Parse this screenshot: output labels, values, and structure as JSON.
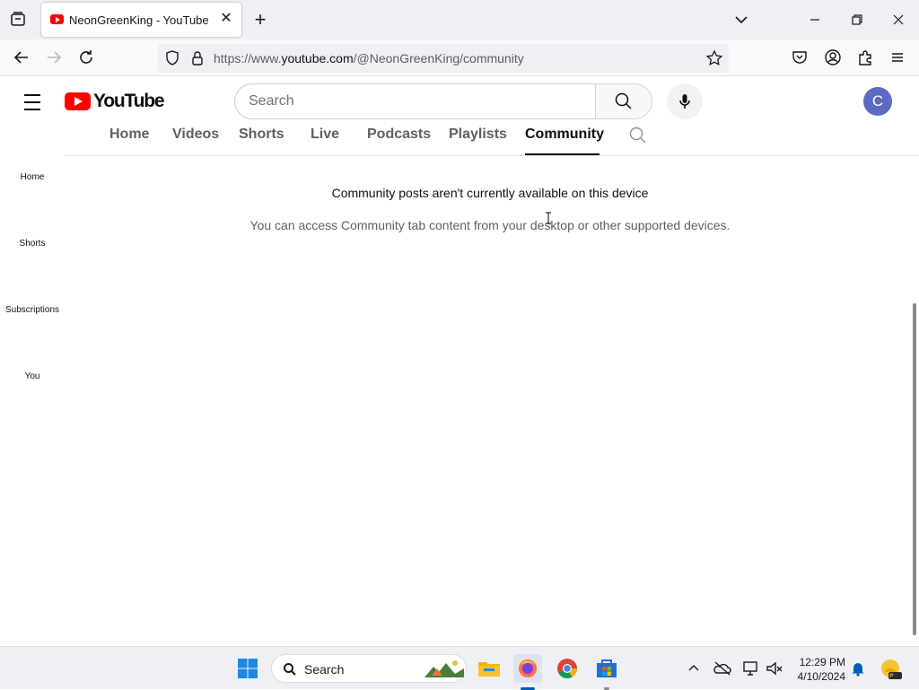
{
  "browser": {
    "tab_title": "NeonGreenKing - YouTube",
    "url_prefix": "https://www.",
    "url_domain": "youtube.com",
    "url_path": "/@NeonGreenKing/community"
  },
  "youtube": {
    "logo_text": "YouTube",
    "search_placeholder": "Search",
    "avatar_letter": "C",
    "brand_color": "#ff0000"
  },
  "channel_tabs": [
    {
      "label": "Home"
    },
    {
      "label": "Videos"
    },
    {
      "label": "Shorts"
    },
    {
      "label": "Live"
    },
    {
      "label": "Podcasts"
    },
    {
      "label": "Playlists"
    },
    {
      "label": "Community",
      "active": true
    }
  ],
  "guide": [
    {
      "label": "Home"
    },
    {
      "label": "Shorts"
    },
    {
      "label": "Subscriptions"
    },
    {
      "label": "You"
    }
  ],
  "main": {
    "title": "Community posts aren't currently available on this device",
    "subtitle": "You can access Community tab content from your desktop or other supported devices."
  },
  "taskbar": {
    "search_label": "Search",
    "time": "12:29 PM",
    "date": "4/10/2024"
  }
}
